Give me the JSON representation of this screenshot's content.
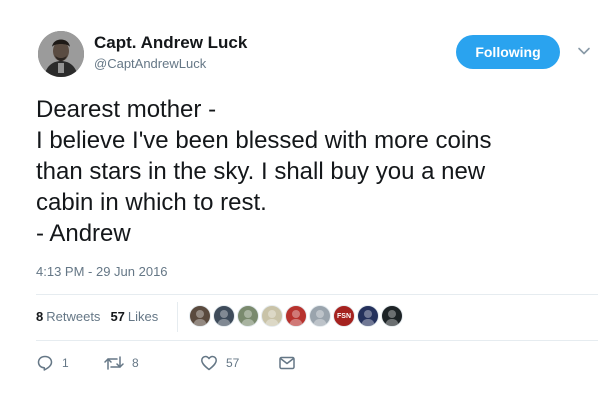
{
  "author": {
    "name": "Capt. Andrew Luck",
    "handle": "@CaptAndrewLuck"
  },
  "follow_button": {
    "label": "Following"
  },
  "tweet": {
    "lines": [
      "Dearest mother -",
      "I believe I've been blessed with more coins",
      "than stars in the sky. I shall buy you a new",
      "cabin in which to rest.",
      "- Andrew"
    ],
    "timestamp": "4:13 PM - 29 Jun 2016"
  },
  "stats": {
    "retweets_count": "8",
    "retweets_label": "Retweets",
    "likes_count": "57",
    "likes_label": "Likes"
  },
  "likers": [
    {
      "color": "#5a4a3e"
    },
    {
      "color": "#3e4b5a"
    },
    {
      "color": "#7a8a6e"
    },
    {
      "color": "#c9c3a8"
    },
    {
      "color": "#b7322e"
    },
    {
      "color": "#9aa4ad"
    },
    {
      "color": "#a5221f",
      "text": "FSN"
    },
    {
      "color": "#24315c"
    },
    {
      "color": "#1d2326"
    }
  ],
  "actions": {
    "reply_count": "1",
    "retweet_count": "8",
    "like_count": "57"
  },
  "colors": {
    "accent": "#2aa3ef",
    "secondary_text": "#657786",
    "divider": "#e6ecf0"
  }
}
